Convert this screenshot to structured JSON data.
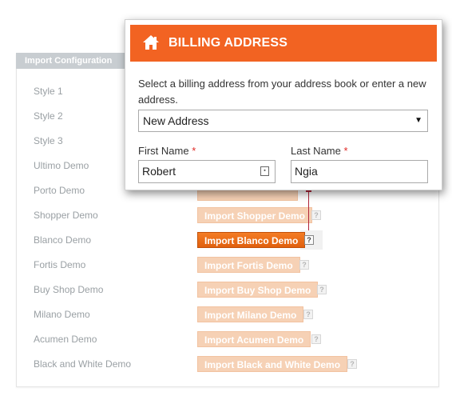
{
  "config": {
    "tab_label": "Import Configuration",
    "rows": [
      {
        "label": "Style 1"
      },
      {
        "label": "Style 2"
      },
      {
        "label": "Style 3"
      },
      {
        "label": "Ultimo Demo"
      },
      {
        "label": "Porto Demo"
      },
      {
        "label": "Shopper Demo",
        "button": "Import Shopper Demo"
      },
      {
        "label": "Blanco Demo",
        "button": "Import Blanco Demo",
        "active": true
      },
      {
        "label": "Fortis Demo",
        "button": "Import Fortis Demo"
      },
      {
        "label": "Buy Shop Demo",
        "button": "Import Buy Shop Demo"
      },
      {
        "label": "Milano Demo",
        "button": "Import Milano Demo"
      },
      {
        "label": "Acumen Demo",
        "button": "Import Acumen Demo"
      },
      {
        "label": "Black and White Demo",
        "button": "Import Black and White Demo"
      }
    ],
    "help_glyph": "?"
  },
  "billing": {
    "title": "BILLING ADDRESS",
    "icon": "home-icon",
    "description": "Select a billing address from your address book or enter a new address.",
    "address_select": {
      "value": "New Address",
      "arrow": "▼"
    },
    "first_name": {
      "label": "First Name",
      "required_mark": "*",
      "value": "Robert"
    },
    "last_name": {
      "label": "Last Name",
      "required_mark": "*",
      "value": "Ngia"
    },
    "contact_icon_glyph": "▪"
  },
  "colors": {
    "header": "#f26322",
    "button_active": "#e8681a",
    "button_faded": "#f6d1b5",
    "connector": "#b0253a"
  }
}
